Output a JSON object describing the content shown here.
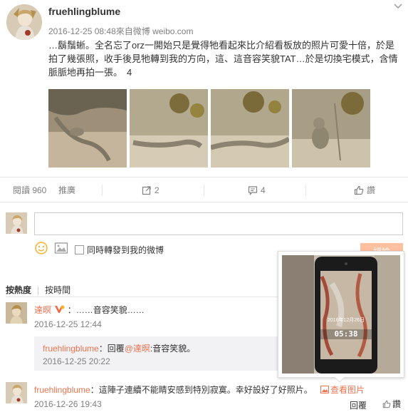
{
  "post": {
    "author": "fruehlingblume",
    "meta": "2016-12-25 08:48來自微博 weibo.com",
    "text": "…鬍鬚蜥。全名忘了orz一開始只是覺得牠看起來比介紹看板放的照片可愛十倍，於是拍了幾張照，收手後見牠轉到我的方向，這、這音容笑貌TAT…於是切換宅模式，含情脈脈地再拍一張。",
    "image_count": "4",
    "images": [
      "lizard-photo-1",
      "lizard-photo-2",
      "lizard-photo-3",
      "lizard-photo-4"
    ]
  },
  "actions": {
    "reads": "閱讀 960",
    "promote": "推廣",
    "repost_count": "2",
    "comment_count": "4",
    "like_count": "讚"
  },
  "compose": {
    "placeholder": "",
    "repost_label": "同時轉發到我的微博",
    "submit_label": "評論"
  },
  "sort": {
    "by_heat": "按熱度",
    "by_time": "按時間"
  },
  "comments": [
    {
      "name": "達暝",
      "sep": "：",
      "text": "……音容笑貌……",
      "time": "2016-12-25 12:44",
      "reply": {
        "name": "fruehlingblume",
        "prefix": "：回覆",
        "mention": "@達暝",
        "text": ":音容笑貌。",
        "time": "2016-12-25 20:22"
      }
    },
    {
      "name": "fruehlingblume",
      "sep": "：",
      "text": "這陣子連續不能睛安感到特別寂寞。幸好設好了好照片。",
      "view_image": "查看图片",
      "time": "2016-12-26 19:43",
      "reply_label": "回覆",
      "like_label": "讚"
    }
  ],
  "popup": {
    "phone_time": "05:38",
    "phone_date": "2016年12月26日"
  }
}
